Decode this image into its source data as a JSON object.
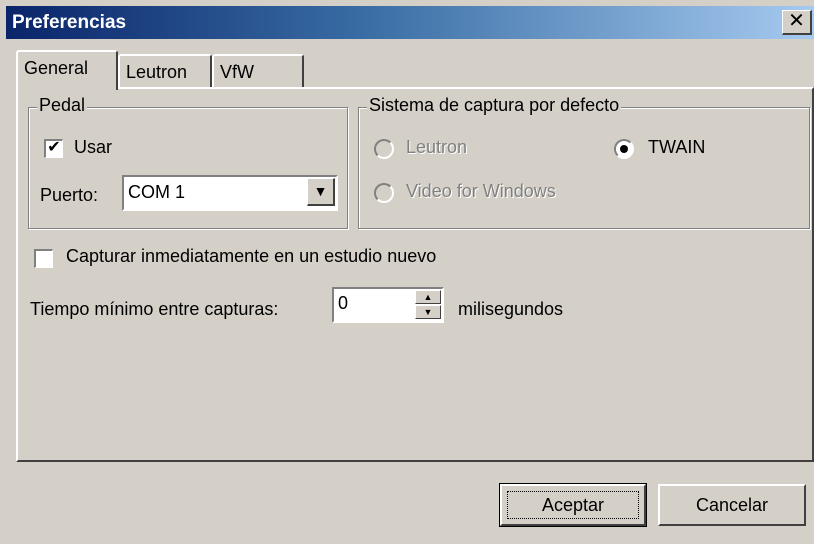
{
  "window": {
    "title": "Preferencias",
    "close_glyph": "✕"
  },
  "tabs": [
    {
      "label": "General",
      "active": true
    },
    {
      "label": "Leutron",
      "active": false
    },
    {
      "label": "VfW",
      "active": false
    }
  ],
  "pedal": {
    "legend": "Pedal",
    "use_label": "Usar",
    "use_checked": true,
    "check_glyph": "✔",
    "port_label": "Puerto:",
    "port_value": "COM 1",
    "dropdown_glyph": "▼"
  },
  "capture_system": {
    "legend": "Sistema de captura por defecto",
    "options": [
      {
        "label": "Leutron",
        "selected": false,
        "enabled": false
      },
      {
        "label": "TWAIN",
        "selected": true,
        "enabled": true
      },
      {
        "label": "Video for Windows",
        "selected": false,
        "enabled": false
      }
    ]
  },
  "capture_immediately": {
    "label": "Capturar inmediatamente en un estudio nuevo",
    "checked": false
  },
  "min_time": {
    "label": "Tiempo mínimo entre capturas:",
    "value": "0",
    "unit": "milisegundos",
    "up_glyph": "▲",
    "down_glyph": "▼"
  },
  "buttons": {
    "accept": "Aceptar",
    "cancel": "Cancelar"
  },
  "colors": {
    "face": "#d4d0c8",
    "title_start": "#0a246a",
    "title_end": "#a6caf0",
    "disabled_text": "#808080"
  }
}
